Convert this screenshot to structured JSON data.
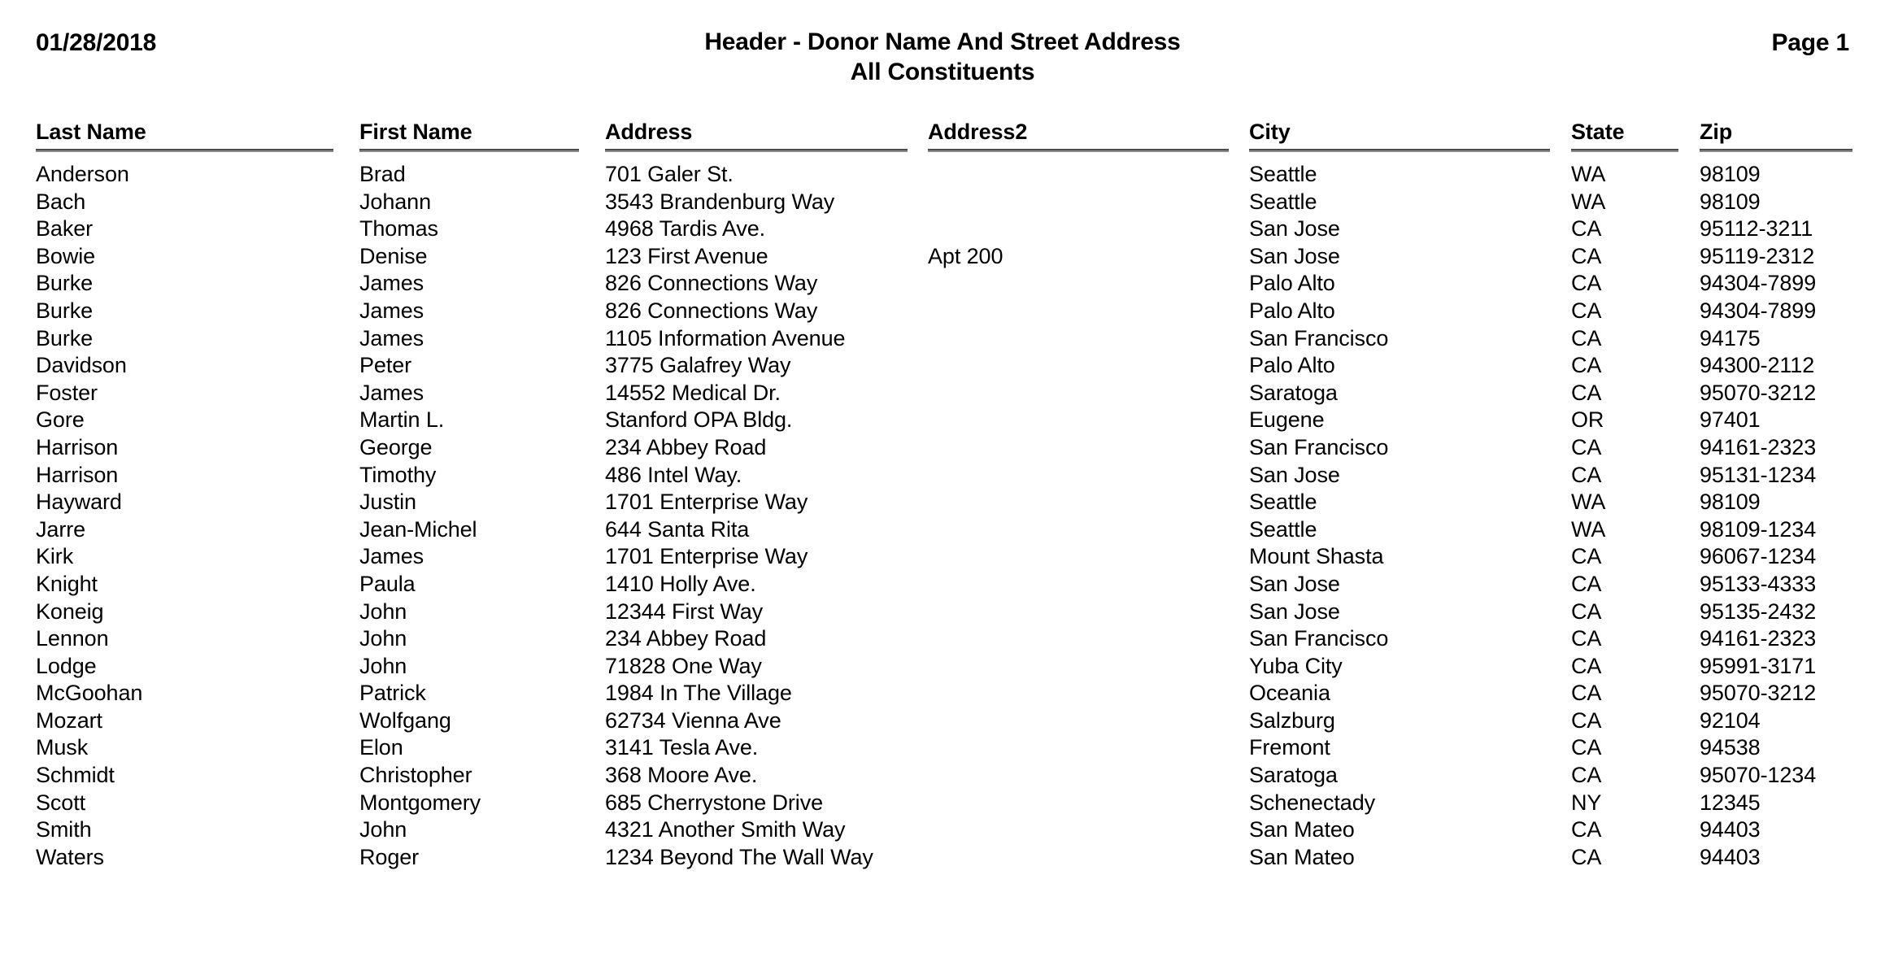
{
  "header": {
    "date": "01/28/2018",
    "title": "Header - Donor Name And Street Address",
    "subtitle": "All Constituents",
    "page_label": "Page 1"
  },
  "table": {
    "columns": [
      {
        "key": "last_name",
        "label": "Last Name"
      },
      {
        "key": "first_name",
        "label": "First Name"
      },
      {
        "key": "address",
        "label": "Address"
      },
      {
        "key": "address2",
        "label": "Address2"
      },
      {
        "key": "city",
        "label": "City"
      },
      {
        "key": "state",
        "label": "State"
      },
      {
        "key": "zip",
        "label": "Zip"
      }
    ],
    "rows": [
      {
        "last_name": "Anderson",
        "first_name": "Brad",
        "address": "701 Galer St.",
        "address2": "",
        "city": "Seattle",
        "state": "WA",
        "zip": "98109"
      },
      {
        "last_name": "Bach",
        "first_name": "Johann",
        "address": "3543 Brandenburg Way",
        "address2": "",
        "city": "Seattle",
        "state": "WA",
        "zip": "98109"
      },
      {
        "last_name": "Baker",
        "first_name": "Thomas",
        "address": "4968 Tardis Ave.",
        "address2": "",
        "city": "San Jose",
        "state": "CA",
        "zip": "95112-3211"
      },
      {
        "last_name": "Bowie",
        "first_name": "Denise",
        "address": "123 First Avenue",
        "address2": "Apt 200",
        "city": "San Jose",
        "state": "CA",
        "zip": "95119-2312"
      },
      {
        "last_name": "Burke",
        "first_name": "James",
        "address": "826 Connections Way",
        "address2": "",
        "city": "Palo Alto",
        "state": "CA",
        "zip": "94304-7899"
      },
      {
        "last_name": "Burke",
        "first_name": "James",
        "address": "826 Connections Way",
        "address2": "",
        "city": "Palo Alto",
        "state": "CA",
        "zip": "94304-7899"
      },
      {
        "last_name": "Burke",
        "first_name": "James",
        "address": "1105 Information Avenue",
        "address2": "",
        "city": "San Francisco",
        "state": "CA",
        "zip": "94175"
      },
      {
        "last_name": "Davidson",
        "first_name": "Peter",
        "address": "3775 Galafrey Way",
        "address2": "",
        "city": "Palo Alto",
        "state": "CA",
        "zip": "94300-2112"
      },
      {
        "last_name": "Foster",
        "first_name": "James",
        "address": "14552 Medical Dr.",
        "address2": "",
        "city": "Saratoga",
        "state": "CA",
        "zip": "95070-3212"
      },
      {
        "last_name": "Gore",
        "first_name": "Martin L.",
        "address": "Stanford OPA Bldg.",
        "address2": "",
        "city": "Eugene",
        "state": "OR",
        "zip": "97401"
      },
      {
        "last_name": "Harrison",
        "first_name": "George",
        "address": "234 Abbey Road",
        "address2": "",
        "city": "San Francisco",
        "state": "CA",
        "zip": "94161-2323"
      },
      {
        "last_name": "Harrison",
        "first_name": "Timothy",
        "address": "486 Intel Way.",
        "address2": "",
        "city": "San Jose",
        "state": "CA",
        "zip": "95131-1234"
      },
      {
        "last_name": "Hayward",
        "first_name": "Justin",
        "address": "1701 Enterprise Way",
        "address2": "",
        "city": "Seattle",
        "state": "WA",
        "zip": "98109"
      },
      {
        "last_name": "Jarre",
        "first_name": "Jean-Michel",
        "address": "644 Santa Rita",
        "address2": "",
        "city": "Seattle",
        "state": "WA",
        "zip": "98109-1234"
      },
      {
        "last_name": "Kirk",
        "first_name": "James",
        "address": "1701 Enterprise Way",
        "address2": "",
        "city": "Mount Shasta",
        "state": "CA",
        "zip": "96067-1234"
      },
      {
        "last_name": "Knight",
        "first_name": "Paula",
        "address": "1410 Holly Ave.",
        "address2": "",
        "city": "San Jose",
        "state": "CA",
        "zip": "95133-4333"
      },
      {
        "last_name": "Koneig",
        "first_name": "John",
        "address": "12344 First Way",
        "address2": "",
        "city": "San Jose",
        "state": "CA",
        "zip": "95135-2432"
      },
      {
        "last_name": "Lennon",
        "first_name": "John",
        "address": "234 Abbey Road",
        "address2": "",
        "city": "San Francisco",
        "state": "CA",
        "zip": "94161-2323"
      },
      {
        "last_name": "Lodge",
        "first_name": "John",
        "address": "71828 One Way",
        "address2": "",
        "city": "Yuba City",
        "state": "CA",
        "zip": "95991-3171"
      },
      {
        "last_name": "McGoohan",
        "first_name": "Patrick",
        "address": "1984 In The Village",
        "address2": "",
        "city": "Oceania",
        "state": "CA",
        "zip": "95070-3212"
      },
      {
        "last_name": "Mozart",
        "first_name": "Wolfgang",
        "address": "62734 Vienna Ave",
        "address2": "",
        "city": "Salzburg",
        "state": "CA",
        "zip": "92104"
      },
      {
        "last_name": "Musk",
        "first_name": "Elon",
        "address": "3141 Tesla Ave.",
        "address2": "",
        "city": "Fremont",
        "state": "CA",
        "zip": "94538"
      },
      {
        "last_name": "Schmidt",
        "first_name": "Christopher",
        "address": "368 Moore Ave.",
        "address2": "",
        "city": "Saratoga",
        "state": "CA",
        "zip": "95070-1234"
      },
      {
        "last_name": "Scott",
        "first_name": "Montgomery",
        "address": "685 Cherrystone Drive",
        "address2": "",
        "city": "Schenectady",
        "state": "NY",
        "zip": "12345"
      },
      {
        "last_name": "Smith",
        "first_name": "John",
        "address": "4321 Another Smith Way",
        "address2": "",
        "city": "San Mateo",
        "state": "CA",
        "zip": "94403"
      },
      {
        "last_name": "Waters",
        "first_name": "Roger",
        "address": "1234 Beyond The Wall Way",
        "address2": "",
        "city": "San Mateo",
        "state": "CA",
        "zip": "94403"
      }
    ]
  }
}
